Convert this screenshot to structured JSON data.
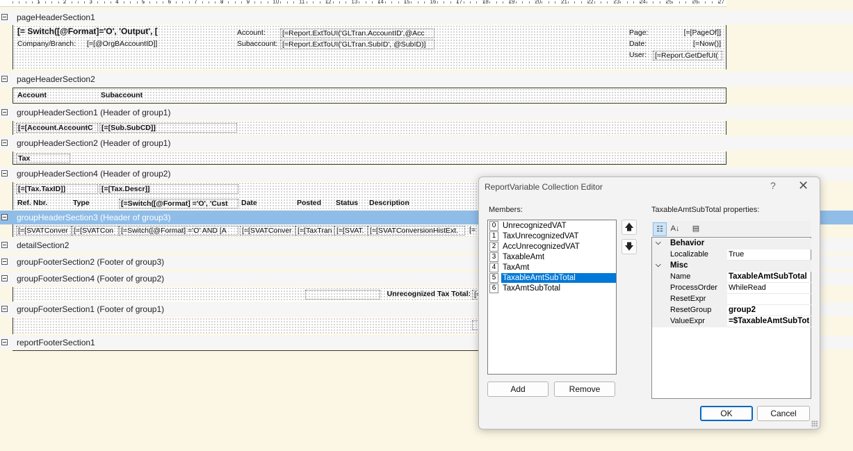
{
  "ruler": {
    "numbers": [
      "1",
      "2",
      "3",
      "4",
      "5",
      "6",
      "7",
      "8",
      "9",
      "10",
      "11",
      "12",
      "13",
      "14",
      "15",
      "16",
      "17",
      "18",
      "19",
      "20",
      "21",
      "22",
      "23",
      "24",
      "25",
      "26",
      "27"
    ]
  },
  "bands": {
    "pageHeader1": {
      "title": "pageHeaderSection1",
      "switch_expr": "[= Switch([@Format]='O', 'Output', [",
      "company_branch_label": "Company/Branch:",
      "company_branch_value": "[=[@OrgBAccountID]]",
      "account_label": "Account:",
      "account_value": "[=Report.ExtToUI('GLTran.AccountID',@Acc",
      "subaccount_label": "Subaccount:",
      "subaccount_value": "[=Report.ExtToUI('GLTran.SubID', @SubID)]",
      "page_label": "Page:",
      "page_value": "[=[PageOf]]",
      "date_label": "Date:",
      "date_value": "[=Now()]",
      "user_label": "User:",
      "user_value": "[=Report.GetDefUI("
    },
    "pageHeader2": {
      "title": "pageHeaderSection2",
      "col_account": "Account",
      "col_subaccount": "Subaccount"
    },
    "groupHeader1": {
      "title": "groupHeaderSection1 (Header of group1)",
      "account_cd": "[=[Account.AccountC",
      "sub_cd": "[=[Sub.SubCD]]"
    },
    "groupHeader2": {
      "title": "groupHeaderSection2 (Header of group1)",
      "tax_label": "Tax"
    },
    "groupHeader4": {
      "title": "groupHeaderSection4 (Header of group2)",
      "tax_id": "[=[Tax.TaxID]]",
      "tax_descr": "[=[Tax.Descr]]",
      "col_ref_nbr": "Ref. Nbr.",
      "col_type": "Type",
      "col_switch": "[=Switch([@Format] ='O', 'Cust",
      "col_date": "Date",
      "col_posted": "Posted",
      "col_status": "Status",
      "col_description": "Description"
    },
    "groupHeader3": {
      "title": "groupHeaderSection3 (Header of group3)",
      "f1": "[=[SVATConver",
      "f2": "[=[SVATCon",
      "f3": "[=Switch([@Format] ='O' AND [A",
      "f4": "[=[SVATConver",
      "f5": "[=[TaxTran",
      "f6": "[=[SVAT.",
      "f7": "[=[SVATConversionHistExt.",
      "f8": "[="
    },
    "detail2": {
      "title": "detailSection2"
    },
    "groupFooter2": {
      "title": "groupFooterSection2 (Footer of group3)"
    },
    "groupFooter4": {
      "title": "groupFooterSection4 (Footer of group2)",
      "unrecognized_label": "Unrecognized Tax Total:",
      "unrecognized_value": "[="
    },
    "groupFooter1": {
      "title": "groupFooterSection1 (Footer of group1)"
    },
    "reportFooter1": {
      "title": "reportFooterSection1"
    }
  },
  "dialog": {
    "title": "ReportVariable Collection Editor",
    "help_glyph": "?",
    "close_glyph": "✕",
    "members_label": "Members:",
    "members": [
      {
        "index": "0",
        "name": "UnrecognizedVAT"
      },
      {
        "index": "1",
        "name": "TaxUnrecognizedVAT"
      },
      {
        "index": "2",
        "name": "AccUnrecognizedVAT"
      },
      {
        "index": "3",
        "name": "TaxableAmt"
      },
      {
        "index": "4",
        "name": "TaxAmt"
      },
      {
        "index": "5",
        "name": "TaxableAmtSubTotal"
      },
      {
        "index": "6",
        "name": "TaxAmtSubTotal"
      }
    ],
    "selected_member_index": 5,
    "move_up_glyph": "🡅",
    "move_down_glyph": "🡇",
    "add_label": "Add",
    "remove_label": "Remove",
    "properties_label": "TaxableAmtSubTotal properties:",
    "categories": {
      "behavior": "Behavior",
      "misc": "Misc"
    },
    "properties": {
      "localizable": {
        "key": "Localizable",
        "value": "True"
      },
      "name": {
        "key": "Name",
        "value": "TaxableAmtSubTotal"
      },
      "process_order": {
        "key": "ProcessOrder",
        "value": "WhileRead"
      },
      "reset_expr": {
        "key": "ResetExpr",
        "value": ""
      },
      "reset_group": {
        "key": "ResetGroup",
        "value": "group2"
      },
      "value_expr": {
        "key": "ValueExpr",
        "value": "=$TaxableAmtSubTot"
      }
    },
    "ok_label": "OK",
    "cancel_label": "Cancel"
  },
  "colors": {
    "canvas": "#fcf7e5",
    "selected_band": "#8fbde8",
    "selection_blue": "#0078d7"
  }
}
